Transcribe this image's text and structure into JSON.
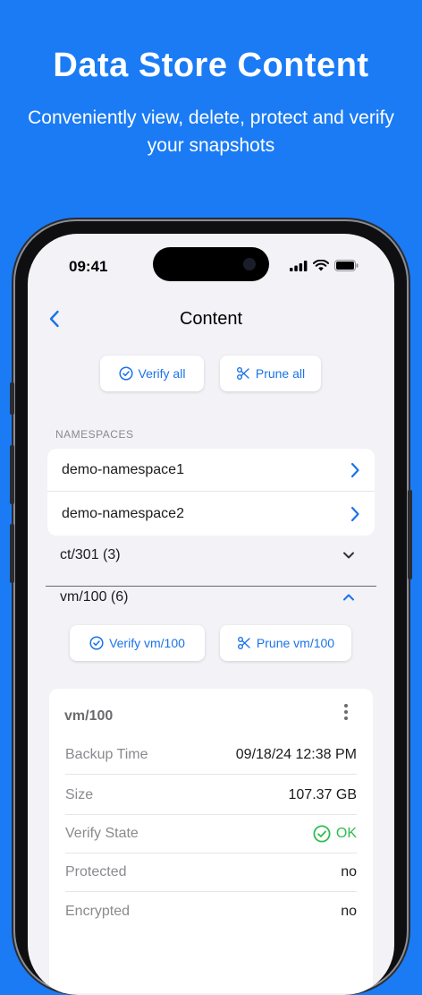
{
  "promo": {
    "title": "Data Store Content",
    "subtitle": "Conveniently view, delete, protect and verify your snapshots"
  },
  "status_bar": {
    "time": "09:41"
  },
  "nav": {
    "title": "Content"
  },
  "actions": {
    "verify_all": "Verify all",
    "prune_all": "Prune all"
  },
  "namespaces": {
    "header": "NAMESPACES",
    "items": [
      {
        "label": "demo-namespace1"
      },
      {
        "label": "demo-namespace2"
      }
    ]
  },
  "groups": [
    {
      "label": "ct/301 (3)",
      "expanded": false
    },
    {
      "label": "vm/100 (6)",
      "expanded": true
    }
  ],
  "group_actions": {
    "verify": "Verify vm/100",
    "prune": "Prune vm/100"
  },
  "snapshot": {
    "title": "vm/100",
    "fields": [
      {
        "key": "Backup Time",
        "value": "09/18/24 12:38 PM"
      },
      {
        "key": "Size",
        "value": "107.37 GB"
      },
      {
        "key": "Verify State",
        "value": "OK"
      },
      {
        "key": "Protected",
        "value": "no"
      },
      {
        "key": "Encrypted",
        "value": "no"
      }
    ]
  },
  "colors": {
    "background": "#1a7bf5",
    "accent": "#1a73e8",
    "ok": "#2fbd4f"
  }
}
